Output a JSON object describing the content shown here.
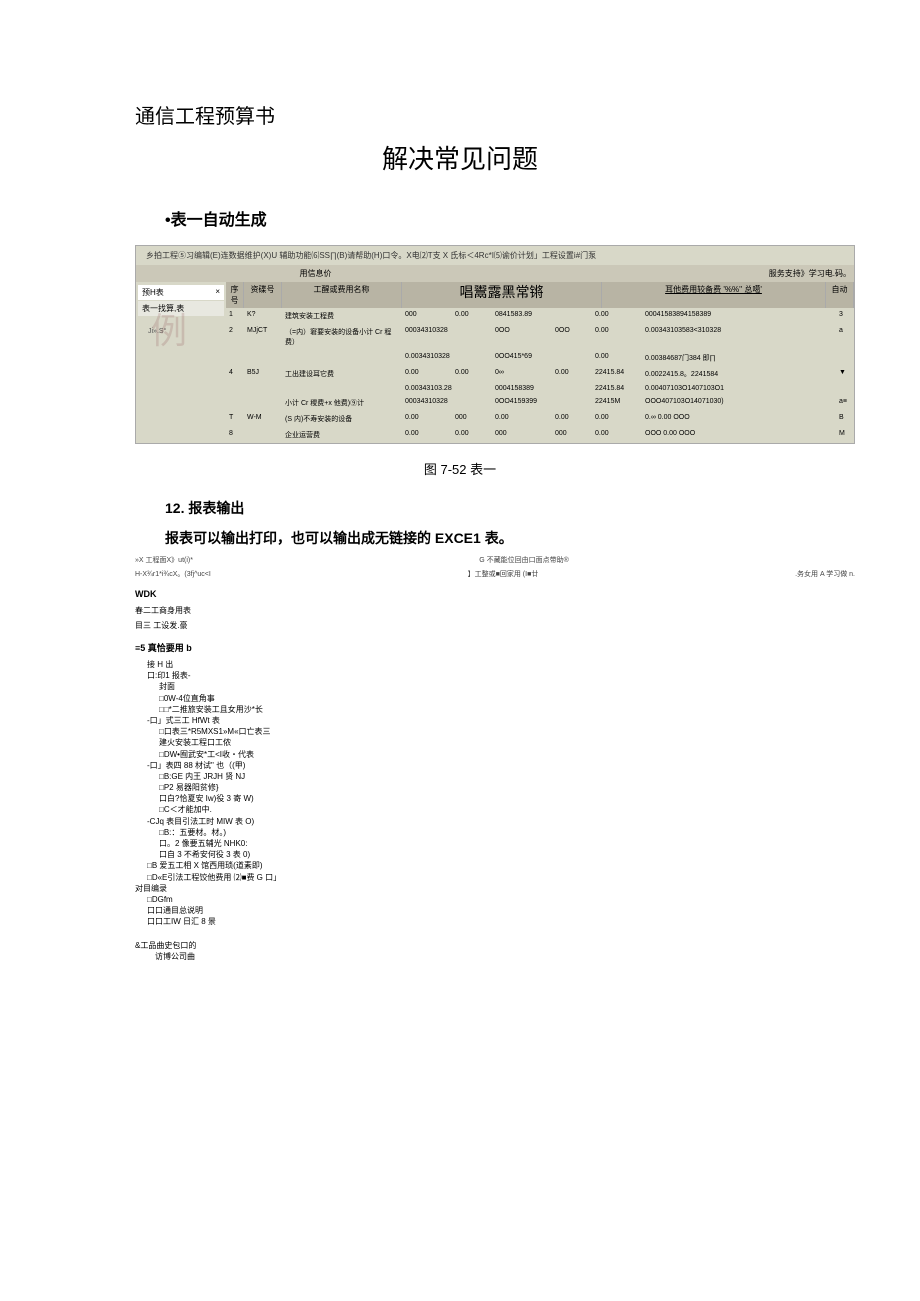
{
  "doc": {
    "title": "通信工程预算书",
    "mainHeading": "解决常见问题",
    "subHeading1": "•表一自动生成",
    "figCaption": "图 7-52 表一",
    "sectionNum": "12. 报表输出",
    "bodyText": "报表可以输出打印，也可以输出成无链接的 EXCE1 表。"
  },
  "shot1": {
    "menuBar": "乡拍工程⑤习编辑(E)连数据维护(X)U 辅助功能⑹SS∏(B)请帮助(H)口令。X电⑵T支 X 氐标＜4Rc*I⑸谕价计划」工程设置i#门泵",
    "gridTitles": [
      "用信息价",
      "服务支持》学习电.码。"
    ],
    "tabs": {
      "tab1": "预H表",
      "tab2": "表一找算,表",
      "wmark": "例",
      "small": "Ji».S°"
    },
    "headers": {
      "h1": "序号",
      "h2": "资碟号",
      "h3": "工醒或费用名称",
      "bigTitle": "唱鬻露黑常锵",
      "h4": "耳他费用较备费 '%%'' 总噶'",
      "h5": "自动"
    },
    "rows": [
      {
        "c1": "1",
        "c2": "K?",
        "c3": "建筑安装工程费",
        "v": [
          "000",
          "0.00",
          "0841583.89",
          "",
          "0.00",
          "00041583894158389"
        ],
        "badge": "3"
      },
      {
        "c1": "2",
        "c2": "MJjCT",
        "c3": "（=内）窘要安装的设备小计 Cr 程费）",
        "v": [
          "00034310328",
          "",
          "0OO",
          "0OO",
          "0.00",
          "0.00343103583<310328"
        ],
        "badge": "a"
      },
      {
        "c1": "",
        "c2": "",
        "c3": "",
        "v": [
          "0.0034310328",
          "",
          "0OO415*69",
          "",
          "0.00",
          "0.00384687门384 即∏"
        ],
        "badge": ""
      },
      {
        "c1": "4",
        "c2": "B5J",
        "c3": "工出建设耳它费",
        "v": [
          "0.00",
          "0.00",
          "0∞",
          "0.00",
          "22415.84",
          "0.0022415.8。2241584"
        ],
        "badge": "▼"
      },
      {
        "c1": "",
        "c2": "",
        "c3": "",
        "v": [
          "0.00343103.28",
          "",
          "0004158389",
          "",
          "22415.84",
          "0.00407103O1407103O1"
        ],
        "badge": ""
      },
      {
        "c1": "",
        "c2": "",
        "c3": "小计 Cr 稷费+x 他费)⑨计",
        "v": [
          "00034310328",
          "",
          "0OO4159399",
          "",
          "22415M",
          "OOO407103O14071030)"
        ],
        "badge": "a≡"
      },
      {
        "c1": "T",
        "c2": "W-M",
        "c3": "(S 内)不寿安装的设备",
        "v": [
          "0.00",
          "000",
          "0.00",
          "0.00",
          "0.00",
          "0.∞     0.00     OOO"
        ],
        "badge": "B"
      },
      {
        "c1": "8",
        "c2": "",
        "c3": "企业运营费",
        "v": [
          "0.00",
          "0.00",
          "000",
          "000",
          "0.00",
          "OOO     0.00     OOO"
        ],
        "badge": "M"
      }
    ]
  },
  "shot2": {
    "line1": {
      "left": "»X 工程面X》ut(i)*",
      "mid": "G 不藏能位回由口面点带助®"
    },
    "line2": {
      "left": "H-X¾r1*i¾cX。(3fj^uc<I",
      "mid": "】工整或■回家用 (I■廿",
      "right": ".务女用 A 学习做 n."
    },
    "bold1": "WDK",
    "line3": "春二工商身用表",
    "line4": "目三 工设发.豪",
    "bold2": "≡5 真恰要用 b",
    "tree": [
      {
        "t": "接 H 出",
        "i": 1
      },
      {
        "t": "口:印1 报表-",
        "i": 1
      },
      {
        "t": "封面",
        "i": 2
      },
      {
        "t": "□0W-4位直角事",
        "i": 2
      },
      {
        "t": "□□*二推旅安装工且女用沙*长",
        "i": 2
      },
      {
        "t": "-口」式三工 HfWt 表",
        "i": 1
      },
      {
        "t": "□口表三*R5MXS1»M«口亡表三",
        "i": 2
      },
      {
        "t": "建火安装工程口工侬",
        "i": 2
      },
      {
        "t": "□DW•囿武安*工<I收・代表",
        "i": 2
      },
      {
        "t": "-口」表四 88 材试\" 也（(甲)",
        "i": 1
      },
      {
        "t": "□B:GE 内王 JRJH 贤 NJ",
        "i": 2
      },
      {
        "t": "□P2 易器阳贫修}",
        "i": 2
      },
      {
        "t": "口白?恰夏安 Iw)役 3 寄 W)",
        "i": 2
      },
      {
        "t": "□C＜才能加中.",
        "i": 2
      },
      {
        "t": "-CJq 表目引法工时 MIW 表 O)",
        "i": 1
      },
      {
        "t": "□B:：五要材。材。)",
        "i": 2
      },
      {
        "t": "口。2 像要五辅光 NHK0:",
        "i": 2
      },
      {
        "t": "口自 3 不希安何役 3 表 0)",
        "i": 2
      },
      {
        "t": "□B 爱五工相 X 馆西用琐(道素即)",
        "i": 1
      },
      {
        "t": "□D«E引法工程饺他费用 ⑵■费 G 口」",
        "i": 1
      },
      {
        "t": "对目编录",
        "i": 0
      },
      {
        "t": "□DGfm",
        "i": 1
      },
      {
        "t": "口口通目总说明",
        "i": 1
      },
      {
        "t": "口口工IW 日汇 8 景",
        "i": 1
      }
    ],
    "foot1": "&工品曲史包口的",
    "foot2": "访博公司曲"
  }
}
